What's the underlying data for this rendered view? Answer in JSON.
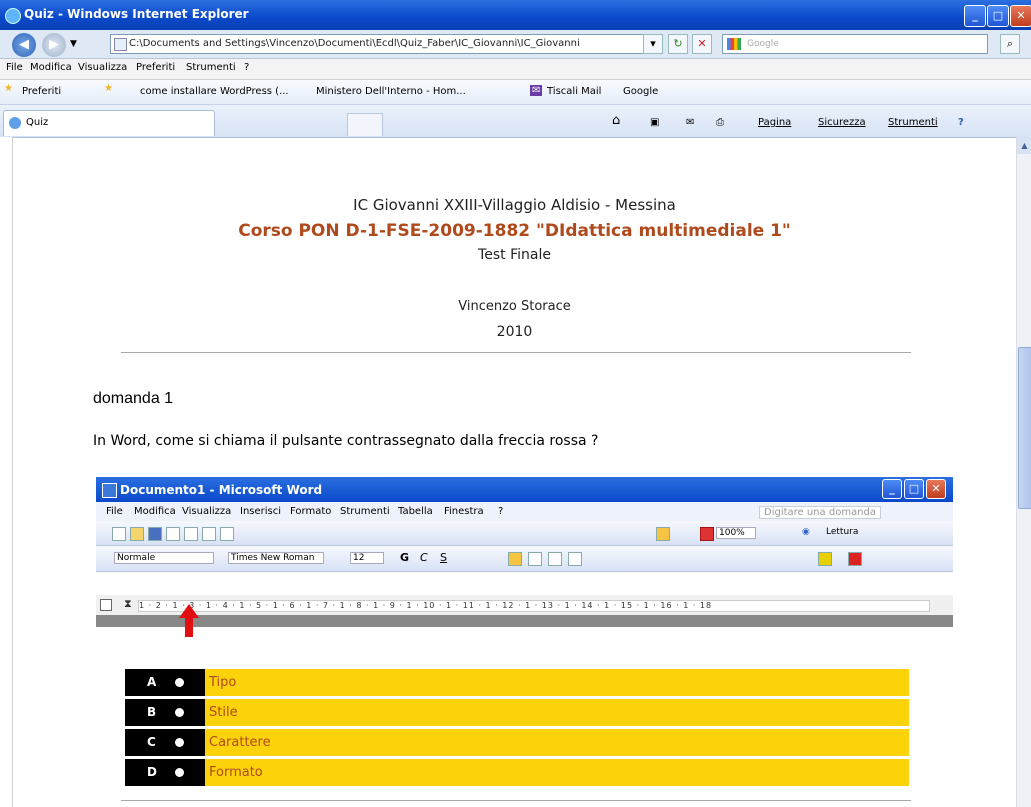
{
  "browser": {
    "title": "Quiz - Windows Internet Explorer",
    "address": "C:\\Documents and Settings\\Vincenzo\\Documenti\\Ecdl\\Quiz_Faber\\IC_Giovanni\\IC_Giovanni",
    "search_placeholder": "Google",
    "menu": [
      "File",
      "Modifica",
      "Visualizza",
      "Preferiti",
      "Strumenti",
      "?"
    ],
    "favorites": {
      "label": "Preferiti",
      "links": [
        "come installare WordPress (...",
        "Ministero Dell'Interno - Hom...",
        "Tiscali Mail",
        "Google"
      ]
    },
    "tab_title": "Quiz",
    "commands": [
      "Pagina",
      "Sicurezza",
      "Strumenti"
    ]
  },
  "page": {
    "school": "IC Giovanni XXIII-Villaggio Aldisio - Messina",
    "course": "Corso PON D-1-FSE-2009-1882 \"DIdattica multimediale 1\"",
    "test": "Test Finale",
    "author": "Vincenzo Storace",
    "year": "2010",
    "question_label": "domanda 1",
    "question_text": "In Word, come si chiama il pulsante contrassegnato dalla freccia rossa ?"
  },
  "word_screenshot": {
    "title": "Documento1 - Microsoft Word",
    "menu": [
      "File",
      "Modifica",
      "Visualizza",
      "Inserisci",
      "Formato",
      "Strumenti",
      "Tabella",
      "Finestra",
      "?"
    ],
    "help_box": "Digitare una domanda",
    "zoom": "100%",
    "reading": "Lettura",
    "style": "Normale",
    "font": "Times New Roman",
    "size": "12",
    "format_buttons": [
      "G",
      "C",
      "S"
    ],
    "ruler": "1 · 2 · 1 · 3 · 1 · 4 · 1 · 5 · 1 · 6 · 1 · 7 · 1 · 8 · 1 · 9 · 1 · 10 · 1 · 11 · 1 · 12 · 1 · 13 · 1 · 14 · 1 · 15 · 1 · 16 · 1 · 18"
  },
  "answers": [
    {
      "letter": "A",
      "text": "Tipo"
    },
    {
      "letter": "B",
      "text": "Stile"
    },
    {
      "letter": "C",
      "text": "Carattere"
    },
    {
      "letter": "D",
      "text": "Formato"
    }
  ],
  "colors": {
    "answer_bg": "#fcd30a",
    "course_title": "#b04a1c",
    "arrow": "#e01010"
  }
}
